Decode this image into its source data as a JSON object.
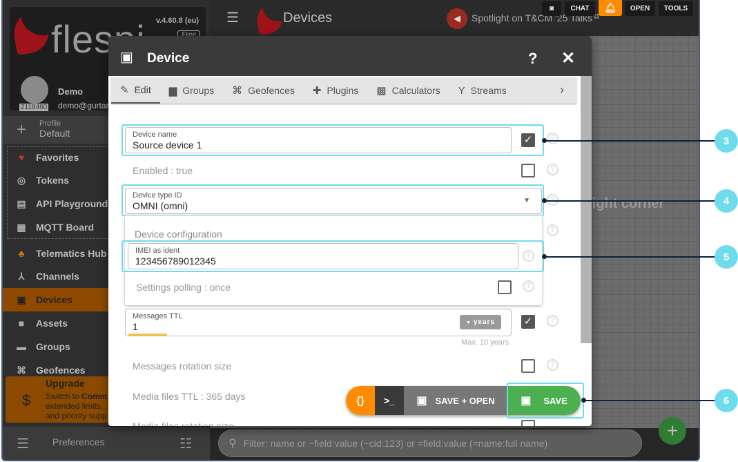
{
  "sidebar": {
    "logo": "flespi",
    "version": "v.4.60.8 (eu)",
    "plan": "Free",
    "user": {
      "name": "Demo",
      "email": "demo@gurtam",
      "id": "2118460"
    },
    "profile": {
      "label": "Profile",
      "value": "Default"
    },
    "pinned": [
      {
        "label": "Favorites"
      },
      {
        "label": "Tokens"
      },
      {
        "label": "API Playground"
      },
      {
        "label": "MQTT Board"
      }
    ],
    "items": [
      {
        "label": "Telematics Hub"
      },
      {
        "label": "Channels"
      },
      {
        "label": "Devices",
        "active": true
      },
      {
        "label": "Assets"
      },
      {
        "label": "Groups"
      },
      {
        "label": "Geofences"
      }
    ],
    "upgrade": {
      "title": "Upgrade",
      "line1_pre": "Switch to ",
      "line1_bold": "Comm",
      "line2": "extended limits, ",
      "line3": "and priority supp"
    },
    "preferences": "Preferences"
  },
  "topbar": {
    "title": "Devices",
    "spotlight": "Spotlight on T&CM '25 Talks",
    "buttons": {
      "chat": "CHAT",
      "open": "OPEN",
      "tools": "TOOLS"
    }
  },
  "main": {
    "hint": "right corner",
    "filter_placeholder": "Filter: name or ~field:value (~cid:123) or =field:value (=name:full name)"
  },
  "dialog": {
    "title": "Device",
    "tabs": [
      {
        "label": "Edit"
      },
      {
        "label": "Groups"
      },
      {
        "label": "Geofences"
      },
      {
        "label": "Plugins"
      },
      {
        "label": "Calculators"
      },
      {
        "label": "Streams"
      }
    ],
    "device_name": {
      "label": "Device name",
      "value": "Source device 1",
      "checked": true
    },
    "enabled": "Enabled : true",
    "device_type": {
      "label": "Device type ID",
      "value": "OMNI (omni)"
    },
    "configuration": {
      "title": "Device configuration",
      "imei": {
        "label": "IMEI as ident",
        "value": "123456789012345"
      },
      "settings_polling": "Settings polling : once"
    },
    "messages_ttl": {
      "label": "Messages TTL",
      "value": "1",
      "unit": "years",
      "max": "Max: 10 years",
      "fill_fraction": 0.1
    },
    "messages_rotation": "Messages rotation size",
    "media_ttl": "Media files TTL : 365 days",
    "media_rotation": "Media files rotation size",
    "actions": {
      "json": "{}",
      "terminal": ">_",
      "save_open": "SAVE + OPEN",
      "save": "SAVE"
    }
  },
  "callouts": [
    "3",
    "4",
    "5",
    "6"
  ],
  "colors": {
    "accent": "#ff8c00",
    "save": "#4caf50",
    "highlight": "#6fdcec",
    "active_nav": "#8f4a00"
  }
}
